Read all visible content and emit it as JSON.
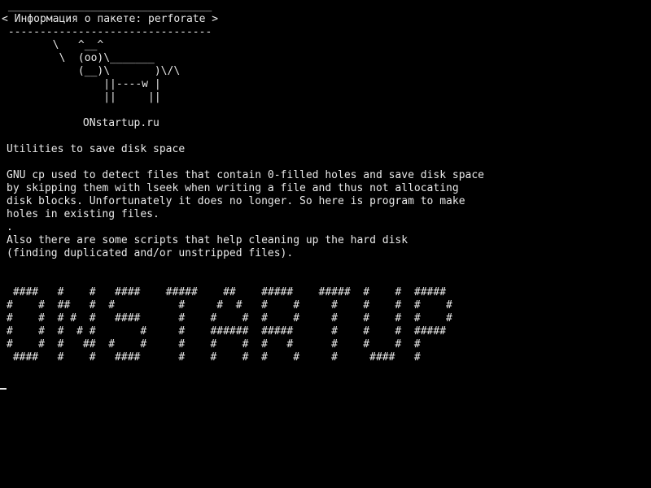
{
  "cowsay": {
    "border_top": " ________________________________",
    "title": "< Информация о пакете: perforate >",
    "border_bottom": " --------------------------------",
    "cow": [
      "        \\   ^__^",
      "         \\  (oo)\\_______",
      "            (__)\\       )\\/\\",
      "                ||----w |",
      "                ||     ||"
    ]
  },
  "site": "            ONstartup.ru",
  "description": {
    "summary": "Utilities to save disk space",
    "body": [
      "GNU cp used to detect files that contain 0-filled holes and save disk space",
      "by skipping them with lseek when writing a file and thus not allocating",
      "disk blocks. Unfortunately it does no longer. So here is program to make",
      "holes in existing files.",
      ".",
      "Also there are some scripts that help cleaning up the hard disk",
      "(finding duplicated and/or unstripped files)."
    ]
  },
  "banner": [
    " ####   #    #   ####    #####    ##    #####    #####  #    #  #####",
    "#    #  ##   #  #          #     #  #   #    #     #    #    #  #    #",
    "#    #  # #  #   ####      #    #    #  #    #     #    #    #  #    #",
    "#    #  #  # #       #     #    ######  #####      #    #    #  #####",
    "#    #  #   ##  #    #     #    #    #  #   #      #    #    #  #",
    " ####   #    #   ####      #    #    #  #    #     #     ####   #"
  ]
}
